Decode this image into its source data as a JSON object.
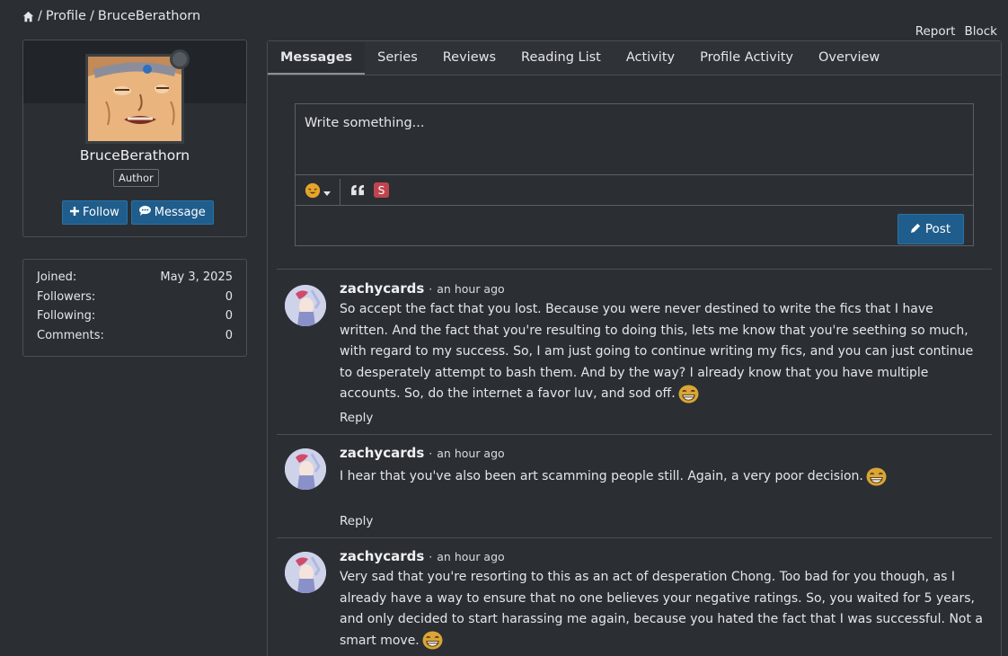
{
  "breadcrumb": {
    "sep1": "/",
    "profile": "Profile",
    "sep2": "/",
    "current": "BruceBerathorn"
  },
  "top_actions": {
    "report": "Report",
    "block": "Block"
  },
  "profile": {
    "username": "BruceBerathorn",
    "role": "Author",
    "follow_label": "Follow",
    "message_label": "Message"
  },
  "stats": [
    {
      "label": "Joined:",
      "value": "May 3, 2025"
    },
    {
      "label": "Followers:",
      "value": "0"
    },
    {
      "label": "Following:",
      "value": "0"
    },
    {
      "label": "Comments:",
      "value": "0"
    }
  ],
  "tabs": [
    "Messages",
    "Series",
    "Reviews",
    "Reading List",
    "Activity",
    "Profile Activity",
    "Overview"
  ],
  "composer": {
    "placeholder": "Write something...",
    "post_label": "Post"
  },
  "comments": [
    {
      "author": "zachycards",
      "time": "an hour ago",
      "text": "So accept the fact that you lost. Because you were never destined to write the fics that I have written. And the fact that you're resulting to doing this, lets me know that you're seething so much, with regard to my success. So, I am just going to continue writing my fics, and you can just continue to desperately attempt to bash them. And by the way? I already know that you have multiple accounts. So, do the internet a favor luv, and sod off.",
      "reply": "Reply"
    },
    {
      "author": "zachycards",
      "time": "an hour ago",
      "text": "I hear that you've also been art scamming people still. Again, a very poor decision.",
      "reply": "Reply"
    },
    {
      "author": "zachycards",
      "time": "an hour ago",
      "text": "Very sad that you're resorting to this as an act of desperation Chong. Too bad for you though, as I already have a way to ensure that no one believes your negative ratings. So, you waited for 5 years, and only decided to start harassing me again, because you hated the fact that I was successful. Not a smart move.",
      "reply": "Reply"
    }
  ],
  "colors": {
    "accent_button": "#1f5d8c",
    "background": "#2b2f33",
    "border": "#4a4f55"
  }
}
